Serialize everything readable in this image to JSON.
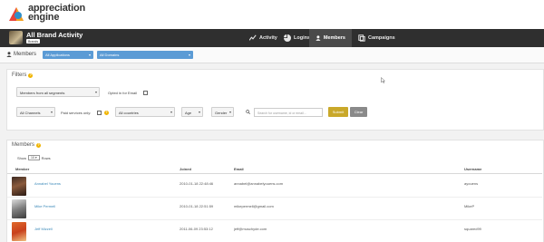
{
  "brand": {
    "name_line1": "appreciation",
    "name_line2": "engine"
  },
  "header": {
    "title": "All Brand Activity",
    "badge": "Brands"
  },
  "nav": {
    "tabs": [
      {
        "label": "Activity",
        "icon": "activity-icon"
      },
      {
        "label": "Logins",
        "icon": "pie-chart-icon"
      },
      {
        "label": "Members",
        "icon": "user-icon",
        "active": true
      },
      {
        "label": "Campaigns",
        "icon": "campaigns-icon"
      }
    ]
  },
  "subheader": {
    "title": "Members",
    "applications_select": "All Applications",
    "domains_select": "All Domains"
  },
  "filters": {
    "title": "Filters",
    "segment_select": "Members from all segments",
    "opted_in_label": "Opted in for Email",
    "channels_select": "All Channels",
    "paid_services_label": "Paid services only:",
    "countries_select": "All countries",
    "age_select": "Age",
    "gender_select": "Gender",
    "search_placeholder": "Search for username, id or email...",
    "submit_label": "Submit",
    "clear_label": "Clear"
  },
  "members": {
    "title": "Members",
    "show_label": "Show",
    "show_value": "10",
    "rows_label": "Rows",
    "columns": [
      "Member",
      "Joined",
      "Email",
      "Username"
    ],
    "rows": [
      {
        "name": "Annabel Youens",
        "joined": "2010-01-18 22:48:46",
        "email": "annabel@annabelyouens.com",
        "username": "ayouens"
      },
      {
        "name": "Mike Permell",
        "joined": "2010-01-18 22:51:59",
        "email": "mikepermell@gmail.com",
        "username": "MikeP"
      },
      {
        "name": "Jeff Mizzell",
        "joined": "2011-06-09 23:53:12",
        "email": "jeff@muschyde.com",
        "username": "squared99"
      }
    ]
  },
  "colors": {
    "accent_blue": "#5b9bd5",
    "submit_gold": "#c9a82a",
    "dark_bar": "#2f2f2f",
    "link": "#3a88b8"
  }
}
